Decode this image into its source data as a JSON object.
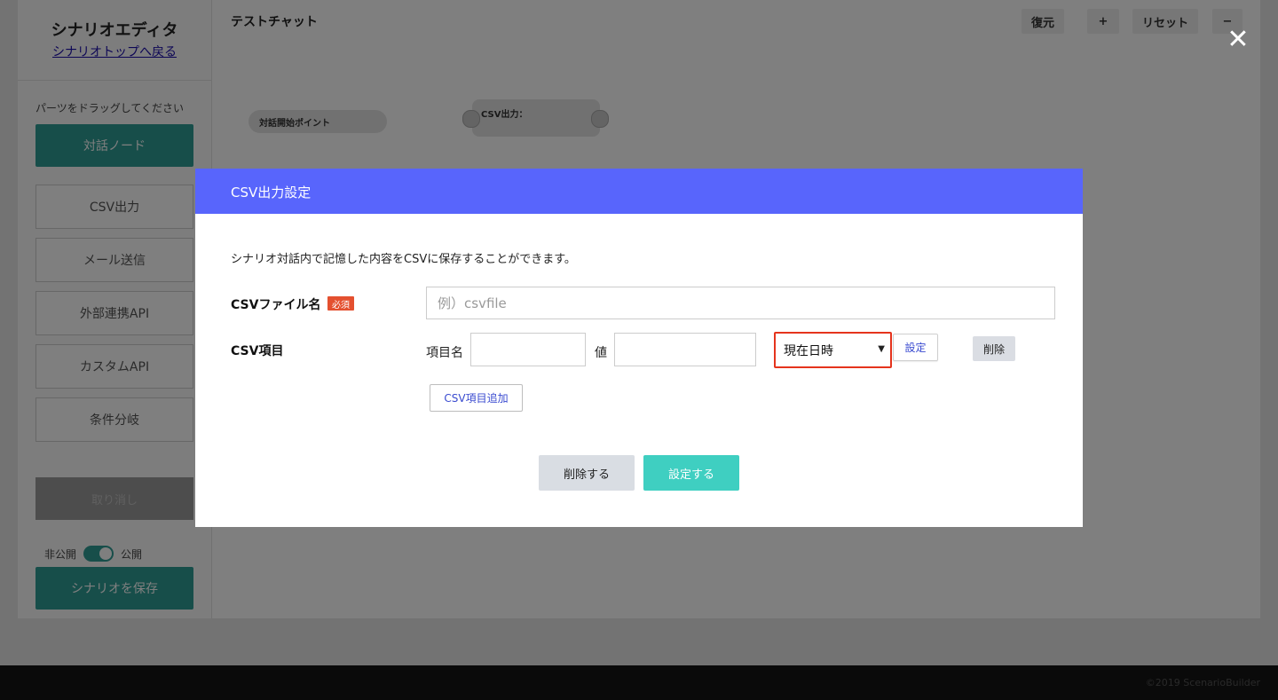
{
  "sidebar": {
    "title": "シナリオエディタ",
    "back_link": "シナリオトップへ戻る",
    "hint": "パーツをドラッグしてください",
    "node_button": "対話ノード",
    "parts": [
      {
        "label": "CSV出力"
      },
      {
        "label": "メール送信"
      },
      {
        "label": "外部連携API"
      },
      {
        "label": "カスタムAPI"
      },
      {
        "label": "条件分岐"
      }
    ],
    "gray_button": "取り消し",
    "toggle_left": "非公開",
    "toggle_right": "公開",
    "save_button": "シナリオを保存"
  },
  "canvas": {
    "title": "テストチャット",
    "toolbar": {
      "restore": "復元",
      "plus": "+",
      "reset": "リセット",
      "minus": "−"
    },
    "nodes": {
      "start": "対話開始ポイント",
      "csv": "CSV出力："
    }
  },
  "modal": {
    "title": "CSV出力設定",
    "description": "シナリオ対話内で記憶した内容をCSVに保存することができます。",
    "file_label": "CSVファイル名",
    "required_badge": "必須",
    "file_placeholder": "例）csvfile",
    "items_label": "CSV項目",
    "item_name_label": "項目名",
    "value_label": "値",
    "select_value": "現在日時",
    "set_small": "設定",
    "delete_small": "削除",
    "add_item": "CSV項目追加",
    "delete_button": "削除する",
    "submit_button": "設定する"
  },
  "footer": {
    "text": "©2019 ScenarioBuilder"
  }
}
